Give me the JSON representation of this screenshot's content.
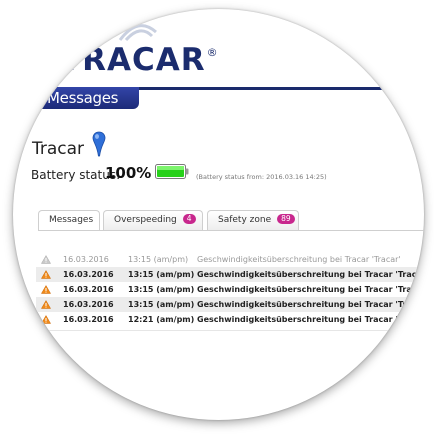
{
  "app": {
    "logo_text": "TRACAR",
    "logo_mark": "®",
    "section_title": "Messages"
  },
  "device": {
    "name": "Tracar",
    "battery_label": "Battery status:",
    "battery_value": "100%",
    "battery_note": "(Battery status from: 2016.03.16 14:25)",
    "battery_color": "#27d11a"
  },
  "tabs": [
    {
      "label": "Messages",
      "badge": null
    },
    {
      "label": "Overspeeding",
      "badge": "4"
    },
    {
      "label": "Safety zone",
      "badge": "89"
    }
  ],
  "colors": {
    "brand": "#1b2c6e",
    "badge": "#c8278d",
    "warning": "#f08a1a"
  },
  "messages": [
    {
      "icon": "warning-icon-grey",
      "date": "16.03.2016",
      "time": "13:15 (am/pm)",
      "text": "Geschwindigkeitsüberschreitung bei Tracar 'Tracar'"
    },
    {
      "icon": "warning-icon",
      "date": "16.03.2016",
      "time": "13:15 (am/pm)",
      "text": "Geschwindigkeitsüberschreitung bei Tracar 'Tracar'"
    },
    {
      "icon": "warning-icon",
      "date": "16.03.2016",
      "time": "13:15 (am/pm)",
      "text": "Geschwindigkeitsüberschreitung bei Tracar 'Tracar'"
    },
    {
      "icon": "warning-icon",
      "date": "16.03.2016",
      "time": "13:15 (am/pm)",
      "text": "Geschwindigkeitsüberschreitung bei Tracar 'Tracar'"
    },
    {
      "icon": "warning-icon",
      "date": "16.03.2016",
      "time": "12:21 (am/pm)",
      "text": "Geschwindigkeitsüberschreitung bei Tracar 'Tracar'"
    }
  ]
}
